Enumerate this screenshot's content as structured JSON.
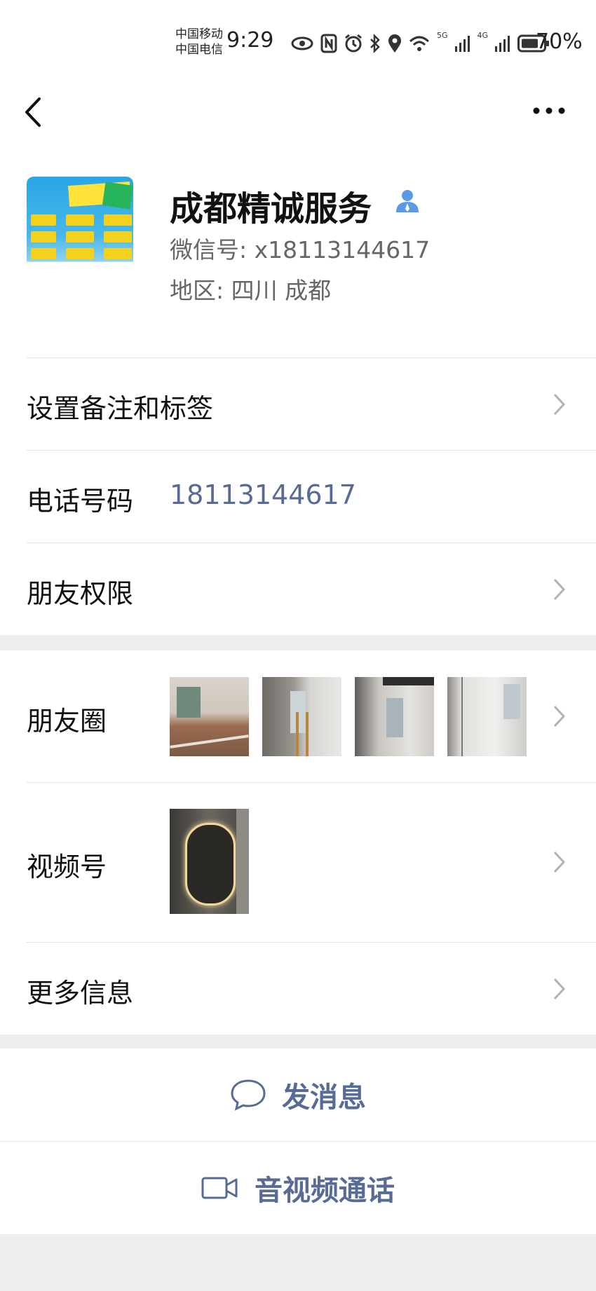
{
  "status_bar": {
    "carrier_1": "中国移动",
    "carrier_2": "中国电信",
    "time": "9:29",
    "signal_1": "5G",
    "signal_2": "4G",
    "battery": "70%"
  },
  "profile": {
    "name": "成都精诚服务",
    "wechat_id": "微信号: x18113144617",
    "region": "地区: 四川  成都"
  },
  "rows": {
    "remark": "设置备注和标签",
    "phone_label": "电话号码",
    "phone_value": "18113144617",
    "permissions": "朋友权限",
    "moments": "朋友圈",
    "channels": "视频号",
    "more_info": "更多信息"
  },
  "actions": {
    "message": "发消息",
    "call": "音视频通话"
  },
  "colors": {
    "link": "#576b95",
    "background": "#ededed"
  }
}
